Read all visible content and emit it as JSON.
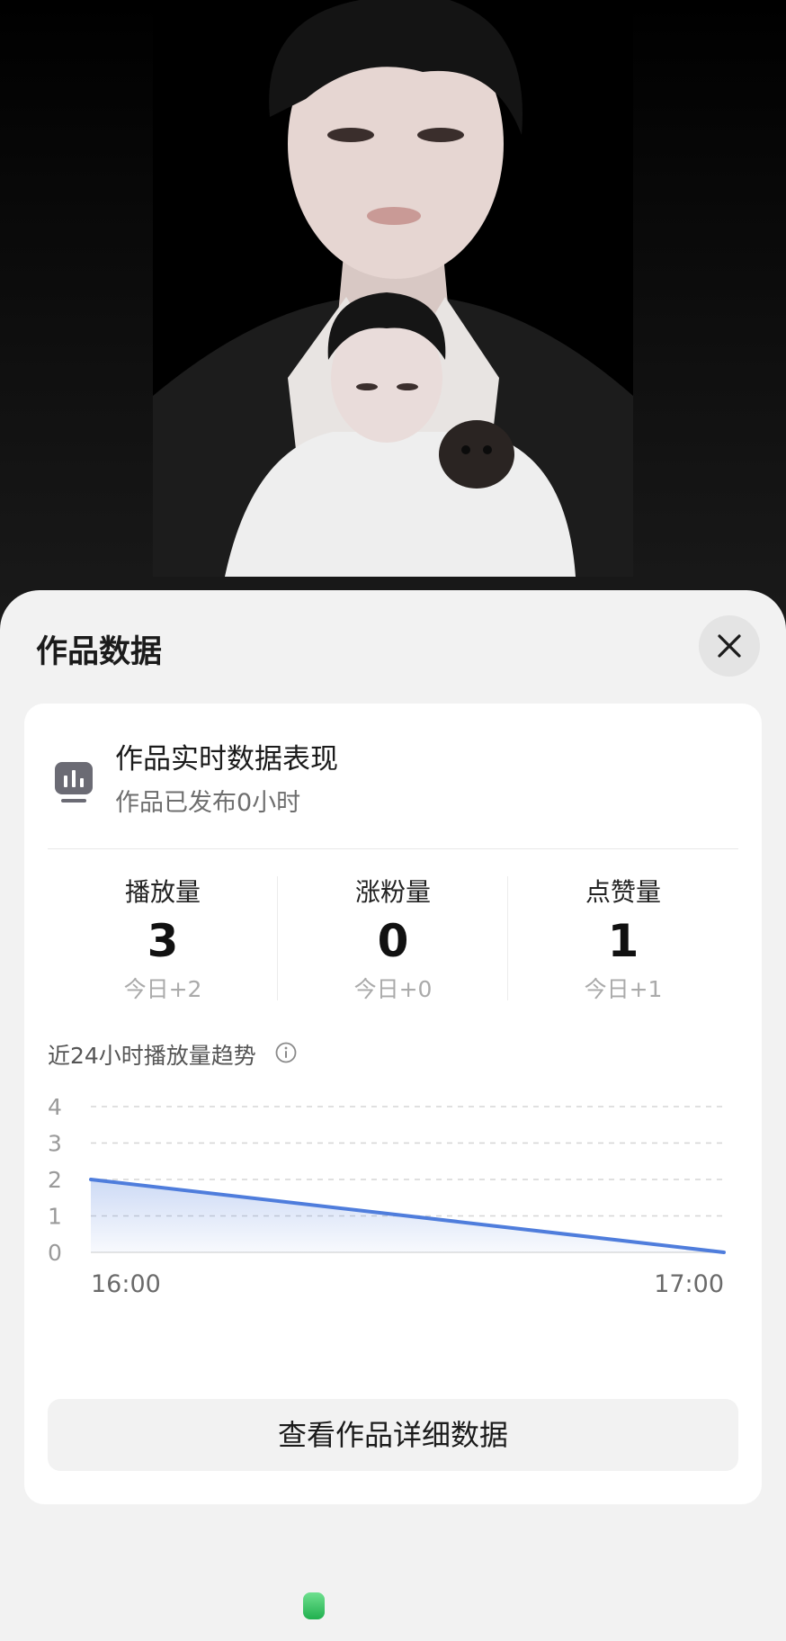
{
  "sheet": {
    "title": "作品数据",
    "close_icon": "close-icon"
  },
  "card": {
    "icon": "bar-chart-icon",
    "title": "作品实时数据表现",
    "subtitle": "作品已发布0小时",
    "stats": [
      {
        "label": "播放量",
        "value": "3",
        "today": "今日+2"
      },
      {
        "label": "涨粉量",
        "value": "0",
        "today": "今日+0"
      },
      {
        "label": "点赞量",
        "value": "1",
        "today": "今日+1"
      }
    ],
    "trend_title": "近24小时播放量趋势",
    "trend_info_icon": "info-icon",
    "detail_button": "查看作品详细数据"
  },
  "chart_data": {
    "type": "area",
    "x": [
      "16:00",
      "17:00"
    ],
    "series": [
      {
        "values": [
          2,
          0
        ]
      }
    ],
    "y_ticks": [
      "0",
      "1",
      "2",
      "3",
      "4"
    ],
    "ylim": [
      0,
      4
    ],
    "grid": true,
    "line_color": "#4f7ddc"
  },
  "colors": {
    "accent": "#4f7ddc",
    "sheet_bg": "#f2f2f2",
    "card_bg": "#ffffff"
  }
}
